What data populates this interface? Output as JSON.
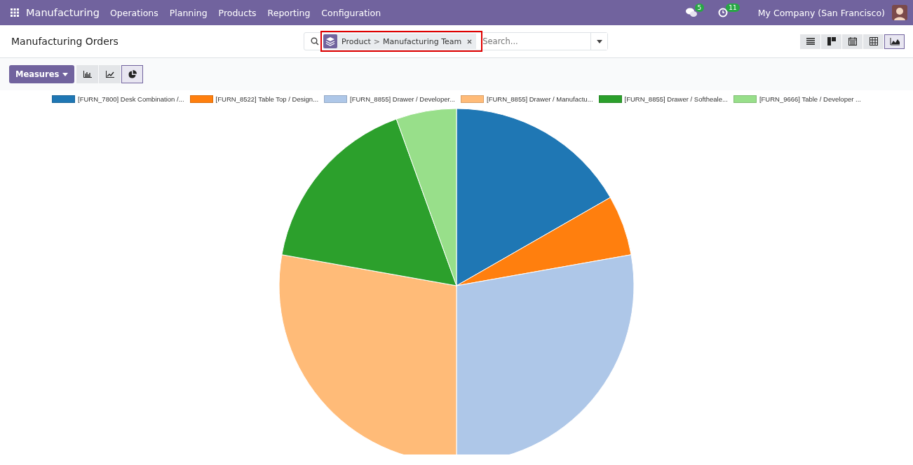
{
  "navbar": {
    "app": "Manufacturing",
    "menu": [
      "Operations",
      "Planning",
      "Products",
      "Reporting",
      "Configuration"
    ],
    "messages_badge": "5",
    "activities_badge": "11",
    "company": "My Company (San Francisco)"
  },
  "control_panel": {
    "title": "Manufacturing Orders",
    "search": {
      "facet": "Product",
      "facet_separator": ">",
      "facet_value": "Manufacturing Team",
      "placeholder": "Search..."
    },
    "views": [
      {
        "kind": "list",
        "selected": false
      },
      {
        "kind": "kanban",
        "selected": false
      },
      {
        "kind": "calendar",
        "selected": false
      },
      {
        "kind": "pivot",
        "selected": false
      },
      {
        "kind": "graph",
        "selected": true
      }
    ]
  },
  "graph_toolbar": {
    "measures": "Measures",
    "modes": [
      {
        "kind": "bar",
        "selected": false
      },
      {
        "kind": "line",
        "selected": false
      },
      {
        "kind": "pie",
        "selected": true
      }
    ]
  },
  "chart_data": {
    "type": "pie",
    "categories": [
      "[FURN_7800] Desk Combination /...",
      "[FURN_8522] Table Top / Design...",
      "[FURN_8855] Drawer / Developer...",
      "[FURN_8855] Drawer / Manufactu...",
      "[FURN_8855] Drawer / Softheale...",
      "[FURN_9666] Table / Developer ..."
    ],
    "legend": "top",
    "series": [
      {
        "values": [
          16.7,
          5.5,
          27.8,
          27.8,
          16.7,
          5.5
        ]
      }
    ],
    "colors": [
      "#1f77b4",
      "#ff7f0e",
      "#aec7e8",
      "#ffbb78",
      "#2ca02c",
      "#98df8a"
    ]
  }
}
